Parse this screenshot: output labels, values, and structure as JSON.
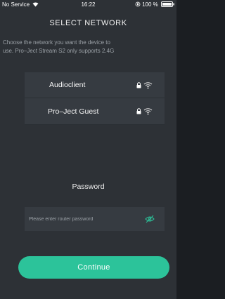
{
  "status_bar": {
    "carrier": "No Service",
    "wifi_icon": "wifi-icon",
    "time": "16:22",
    "orientation_lock_icon": "orientation-lock-icon",
    "battery_percent": "100 %",
    "battery_icon": "battery-icon"
  },
  "header": {
    "title": "SELECT NETWORK",
    "instruction_line_1": "Choose the network you want the device to",
    "instruction_line_2": "use. Pro–Ject Stream S2 only supports 2.4G"
  },
  "networks": [
    {
      "name": "Audioclient",
      "lock_icon": "lock-icon",
      "signal_icon": "wifi-icon"
    },
    {
      "name": "Pro–Ject Guest",
      "lock_icon": "lock-icon",
      "signal_icon": "wifi-icon"
    }
  ],
  "password": {
    "label": "Password",
    "placeholder": "Please enter router password",
    "value": "",
    "toggle_icon": "eye-off-icon"
  },
  "continue_button": {
    "label": "Continue"
  },
  "colors": {
    "background": "#2d3136",
    "panel": "#363b41",
    "accent": "#2cc39a",
    "muted_text": "#9aa0a6"
  }
}
